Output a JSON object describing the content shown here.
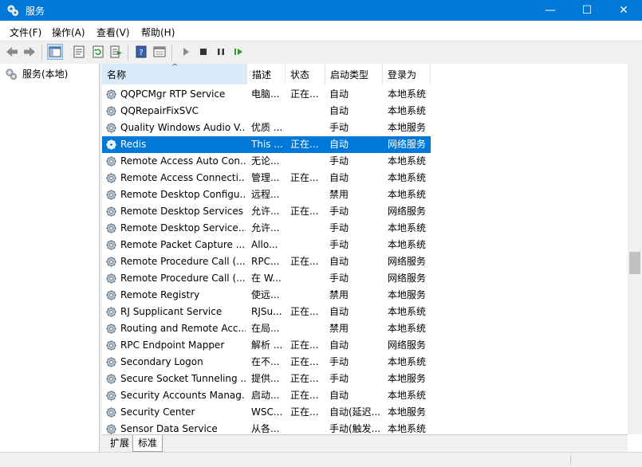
{
  "window": {
    "title": "服务",
    "minimize_icon": "—",
    "maximize_icon": "☐",
    "close_icon": "✕"
  },
  "menu": [
    "文件(F)",
    "操作(A)",
    "查看(V)",
    "帮助(H)"
  ],
  "toolbar": {
    "icons": [
      "back-icon",
      "forward-icon",
      "console-tree-icon",
      "properties-icon",
      "refresh-icon",
      "export-list-icon",
      "help-icon",
      "mmc-view-icon",
      "start-service-icon",
      "stop-service-icon",
      "pause-service-icon",
      "resume-service-icon"
    ]
  },
  "tree": {
    "label": "服务(本地)"
  },
  "columns": {
    "name": "名称",
    "desc": "描述",
    "status": "状态",
    "startup": "启动类型",
    "logon": "登录为",
    "sorted_by": "name",
    "sort_direction": "ascending"
  },
  "services": [
    {
      "name": "QQPCMgr RTP Service",
      "desc": "电脑...",
      "status": "正在...",
      "startup": "自动",
      "logon": "本地系统"
    },
    {
      "name": "QQRepairFixSVC",
      "desc": "",
      "status": "",
      "startup": "自动",
      "logon": "本地系统"
    },
    {
      "name": "Quality Windows Audio V...",
      "desc": "优质 ...",
      "status": "",
      "startup": "手动",
      "logon": "本地服务"
    },
    {
      "name": "Redis",
      "desc": "This ...",
      "status": "正在...",
      "startup": "自动",
      "logon": "网络服务",
      "selected": true
    },
    {
      "name": "Remote Access Auto Con...",
      "desc": "无论...",
      "status": "",
      "startup": "手动",
      "logon": "本地系统"
    },
    {
      "name": "Remote Access Connecti...",
      "desc": "管理...",
      "status": "正在...",
      "startup": "自动",
      "logon": "本地系统"
    },
    {
      "name": "Remote Desktop Configu...",
      "desc": "远程...",
      "status": "",
      "startup": "禁用",
      "logon": "本地系统"
    },
    {
      "name": "Remote Desktop Services",
      "desc": "允许...",
      "status": "正在...",
      "startup": "手动",
      "logon": "网络服务"
    },
    {
      "name": "Remote Desktop Service...",
      "desc": "允许...",
      "status": "",
      "startup": "手动",
      "logon": "本地系统"
    },
    {
      "name": "Remote Packet Capture ...",
      "desc": "Allo...",
      "status": "",
      "startup": "手动",
      "logon": "本地系统"
    },
    {
      "name": "Remote Procedure Call (...",
      "desc": "RPC...",
      "status": "正在...",
      "startup": "自动",
      "logon": "网络服务"
    },
    {
      "name": "Remote Procedure Call (...",
      "desc": "在 W...",
      "status": "",
      "startup": "手动",
      "logon": "网络服务"
    },
    {
      "name": "Remote Registry",
      "desc": "使远...",
      "status": "",
      "startup": "禁用",
      "logon": "本地服务"
    },
    {
      "name": "RJ Supplicant Service",
      "desc": "RJSu...",
      "status": "正在...",
      "startup": "自动",
      "logon": "本地系统"
    },
    {
      "name": "Routing and Remote Acc...",
      "desc": "在局...",
      "status": "",
      "startup": "禁用",
      "logon": "本地系统"
    },
    {
      "name": "RPC Endpoint Mapper",
      "desc": "解析 ...",
      "status": "正在...",
      "startup": "自动",
      "logon": "网络服务"
    },
    {
      "name": "Secondary Logon",
      "desc": "在不...",
      "status": "正在...",
      "startup": "手动",
      "logon": "本地系统"
    },
    {
      "name": "Secure Socket Tunneling ...",
      "desc": "提供...",
      "status": "正在...",
      "startup": "手动",
      "logon": "本地服务"
    },
    {
      "name": "Security Accounts Manag...",
      "desc": "启动...",
      "status": "正在...",
      "startup": "自动",
      "logon": "本地系统"
    },
    {
      "name": "Security Center",
      "desc": "WSC...",
      "status": "正在...",
      "startup": "自动(延迟...",
      "logon": "本地服务"
    },
    {
      "name": "Sensor Data Service",
      "desc": "从各...",
      "status": "",
      "startup": "手动(触发...",
      "logon": "本地系统"
    }
  ],
  "tabs": [
    "扩展",
    "标准"
  ],
  "active_tab": "标准",
  "colors": {
    "titlebar": "#0078d7",
    "selection": "#0078d7",
    "sorted_header": "#d9ebf9"
  }
}
